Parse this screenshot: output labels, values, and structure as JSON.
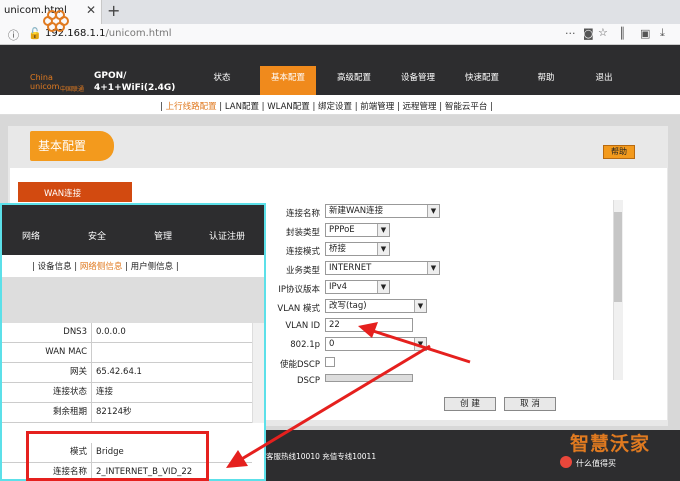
{
  "browser": {
    "tab_title": "unicom.html",
    "url_host": "192.168.1.1",
    "url_path": "/unicom.html"
  },
  "header": {
    "brand_en": "China",
    "brand_en2": "unicom",
    "brand_cn": "中国联通",
    "model_line1": "GPON/",
    "model_line2": "4+1+WiFi(2.4G)",
    "nav": [
      "状态",
      "基本配置",
      "高级配置",
      "设备管理",
      "快速配置",
      "帮助",
      "退出"
    ],
    "active_nav": "基本配置"
  },
  "subnav": {
    "active": "上行线路配置",
    "items": " | LAN配置 | WLAN配置 | 绑定设置 | 前端管理 | 远程管理 | 智能云平台 |"
  },
  "panel": {
    "title": "基本配置",
    "help_label": "帮助",
    "section_label": "WAN连接"
  },
  "form": {
    "fields": [
      {
        "label": "连接名称",
        "value": "新建WAN连接"
      },
      {
        "label": "封装类型",
        "value": "PPPoE"
      },
      {
        "label": "连接模式",
        "value": "桥接"
      },
      {
        "label": "业务类型",
        "value": "INTERNET"
      },
      {
        "label": "IP协议版本",
        "value": "IPv4"
      },
      {
        "label": "VLAN 模式",
        "value": "改写(tag)"
      },
      {
        "label": "VLAN ID",
        "value": "22"
      },
      {
        "label": "802.1p",
        "value": "0"
      },
      {
        "label": "使能DSCP",
        "value": ""
      },
      {
        "label": "DSCP",
        "value": ""
      }
    ],
    "create_label": "创 建",
    "cancel_label": "取 消"
  },
  "footer": {
    "hotline": "客服热线10010 充值专线10011"
  },
  "watermark": {
    "brand": "智慧沃家",
    "site": "什么值得买"
  },
  "overlay": {
    "nav": [
      "网络",
      "安全",
      "管理",
      "认证注册"
    ],
    "subnav_pre": "| 设备信息 | ",
    "subnav_active": "网络侧信息",
    "subnav_post": " | 用户侧信息 |",
    "rows": [
      {
        "key": "DNS3",
        "value": "0.0.0.0"
      },
      {
        "key": "WAN MAC",
        "value": ""
      },
      {
        "key": "网关",
        "value": "65.42.64.1"
      },
      {
        "key": "连接状态",
        "value": "连接"
      },
      {
        "key": "剩余租期",
        "value": "82124秒"
      }
    ],
    "rows2": [
      {
        "key": "模式",
        "value": "Bridge"
      },
      {
        "key": "连接名称",
        "value": "2_INTERNET_B_VID_22"
      }
    ]
  },
  "colors": {
    "accent": "#f08a1c",
    "header_bg": "#2d2d2f",
    "overlay_border": "#5ce0e9",
    "annotation_red": "#e5201e"
  }
}
